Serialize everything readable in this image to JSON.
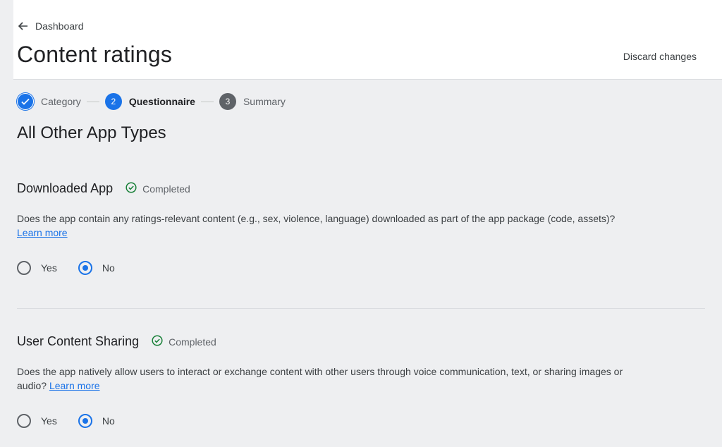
{
  "header": {
    "breadcrumb": "Dashboard",
    "title": "Content ratings",
    "discard_label": "Discard changes"
  },
  "stepper": {
    "steps": [
      {
        "number": "",
        "label": "Category",
        "state": "done"
      },
      {
        "number": "2",
        "label": "Questionnaire",
        "state": "active"
      },
      {
        "number": "3",
        "label": "Summary",
        "state": "pending"
      }
    ]
  },
  "section": {
    "heading": "All Other App Types"
  },
  "questions": [
    {
      "title": "Downloaded App",
      "status": "Completed",
      "text": "Does the app contain any ratings-relevant content (e.g., sex, violence, language) downloaded as part of the app package (code, assets)?",
      "link": "Learn more",
      "options": [
        {
          "label": "Yes",
          "selected": false
        },
        {
          "label": "No",
          "selected": true
        }
      ]
    },
    {
      "title": "User Content Sharing",
      "status": "Completed",
      "text": "Does the app natively allow users to interact or exchange content with other users through voice communication, text, or sharing images or audio?",
      "link": "Learn more",
      "options": [
        {
          "label": "Yes",
          "selected": false
        },
        {
          "label": "No",
          "selected": true
        }
      ]
    }
  ],
  "colors": {
    "accent": "#1a73e8",
    "completed_green": "#188038",
    "background": "#eeeff1"
  }
}
